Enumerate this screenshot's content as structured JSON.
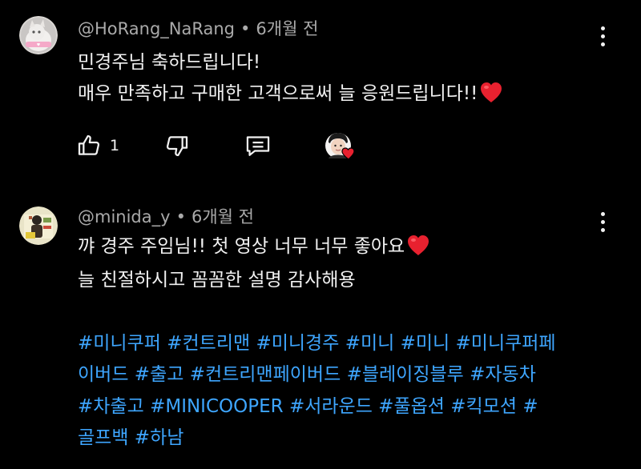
{
  "colors": {
    "background": "#000000",
    "text_primary": "#f1f1f1",
    "text_secondary": "#aaaaaa",
    "hashtag": "#3ea6ff",
    "heart": "#e8212f"
  },
  "comments": [
    {
      "author": "@HoRang_NaRang",
      "separator": "•",
      "time": "6개월 전",
      "avatar_icon": "cat-avatar-icon",
      "body_lines": [
        "민경주님 축하드립니다!",
        "매우 만족하고 구매한 고객으로써 늘 응원드립니다!!"
      ],
      "trailing_emoji": "heart-emoji",
      "like_count": "1",
      "actions": [
        "like-icon",
        "dislike-icon",
        "reply-icon",
        "creator-heart-icon"
      ]
    },
    {
      "author": "@minida_y",
      "separator": "•",
      "time": "6개월 전",
      "avatar_icon": "user-avatar-icon",
      "body_lines": [
        "꺄 경주 주임님!! 첫 영상 너무 너무 좋아요",
        "늘 친절하시고 꼼꼼한 설명 감사해용"
      ],
      "trailing_emoji": "heart-emoji",
      "hashtag_lines": [
        [
          "#미니쿠퍼",
          "#컨트리맨",
          "#미니경주",
          "#미니",
          "#미니",
          "#미니쿠퍼페"
        ],
        [
          "이버드",
          "#출고",
          "#컨트리맨페이버드",
          "#블레이징블루",
          "#자동차"
        ],
        [
          "#차출고",
          "#MINICOOPER",
          "#서라운드",
          "#풀옵션",
          "#킥모션",
          "#"
        ],
        [
          "골프백",
          "#하남"
        ]
      ]
    }
  ]
}
